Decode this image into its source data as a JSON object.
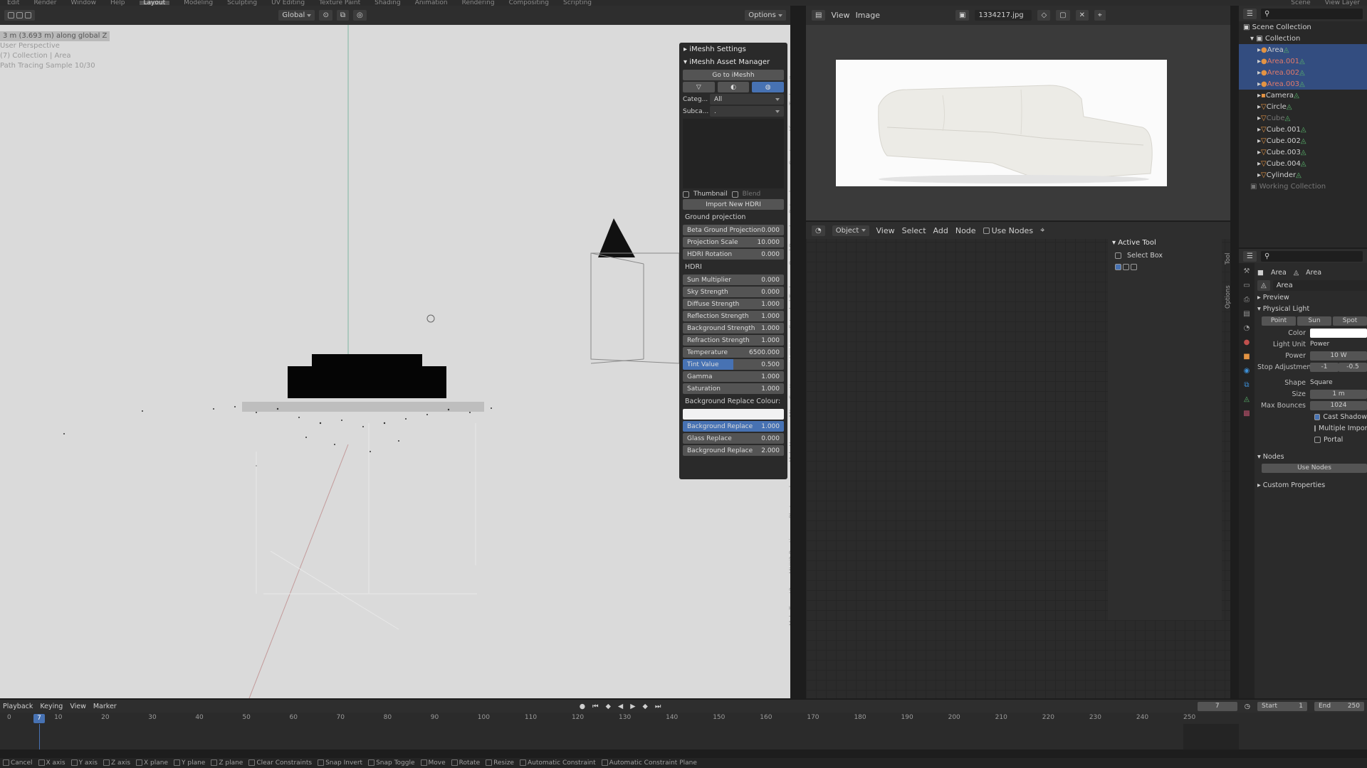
{
  "topbar": {
    "tabs": [
      "Edit",
      "Render",
      "Window",
      "Help",
      "Layout",
      "Modeling",
      "Sculpting",
      "UV Editing",
      "Texture Paint",
      "Shading",
      "Animation",
      "Rendering",
      "Compositing",
      "Scripting"
    ],
    "scene": "Scene",
    "view_layer": "View Layer"
  },
  "viewport": {
    "orientation": "Global",
    "options": "Options",
    "info_line1": "3 m (3.693 m) along global Z",
    "info_line2": "User Perspective",
    "info_line3": "(7) Collection | Area",
    "info_line4": "Path Tracing Sample 10/30"
  },
  "npanel": {
    "settings_title": "iMeshh Settings",
    "asset_manager_title": "iMeshh Asset Manager",
    "goto_button": "Go to iMeshh",
    "category_label": "Categ...",
    "category_value": "All",
    "subcategory_label": "Subca...",
    "subcategory_value": ".",
    "thumbnail_label": "Thumbnail",
    "blend_label": "Blend",
    "import_button": "Import New HDRI",
    "ground_section": "Ground projection",
    "ground_fields": [
      {
        "label": "Beta Ground Projection",
        "value": "0.000"
      },
      {
        "label": "Projection Scale",
        "value": "10.000"
      },
      {
        "label": "HDRI Rotation",
        "value": "0.000"
      }
    ],
    "hdri_section": "HDRI",
    "hdri_fields": [
      {
        "label": "Sun Multiplier",
        "value": "0.000"
      },
      {
        "label": "Sky Strength",
        "value": "0.000"
      },
      {
        "label": "Diffuse Strength",
        "value": "1.000"
      },
      {
        "label": "Reflection Strength",
        "value": "1.000"
      },
      {
        "label": "Background Strength",
        "value": "1.000"
      },
      {
        "label": "Refraction Strength",
        "value": "1.000"
      },
      {
        "label": "Temperature",
        "value": "6500.000"
      },
      {
        "label": "Tint Value",
        "value": "0.500"
      },
      {
        "label": "Gamma",
        "value": "1.000"
      },
      {
        "label": "Saturation",
        "value": "1.000"
      }
    ],
    "bg_colour_label": "Background Replace Colour:",
    "bg_fields": [
      {
        "label": "Background Replace",
        "value": "1.000"
      },
      {
        "label": "Glass Replace",
        "value": "0.000"
      },
      {
        "label": "Background Replace",
        "value": "2.000"
      }
    ],
    "vertical_tabs": [
      "Item",
      "Tool",
      "View",
      "Create",
      "Retopology",
      "Quad Remesh",
      "Extended Tools",
      "iMeshh",
      "Scatter",
      "AN",
      "MakeHuman",
      "Photographer",
      "MHX2 Runtime",
      "MakeTarget2"
    ]
  },
  "image_editor": {
    "menu_view": "View",
    "menu_image": "Image",
    "filename": "1334217.jpg"
  },
  "node_editor": {
    "mode": "Object",
    "menu": [
      "View",
      "Select",
      "Add",
      "Node"
    ],
    "use_nodes": "Use Nodes",
    "active_tool_title": "Active Tool",
    "select_box": "Select Box",
    "side_tabs": [
      "Tool",
      "Options"
    ]
  },
  "outliner": {
    "scene_collection": "Scene Collection",
    "collection": "Collection",
    "items": [
      {
        "name": "Area",
        "sel": true,
        "type": "light"
      },
      {
        "name": "Area.001",
        "sel": true,
        "type": "light"
      },
      {
        "name": "Area.002",
        "sel": true,
        "type": "light"
      },
      {
        "name": "Area.003",
        "sel": true,
        "type": "light"
      },
      {
        "name": "Camera",
        "sel": false,
        "type": "camera"
      },
      {
        "name": "Circle",
        "sel": false,
        "type": "mesh"
      },
      {
        "name": "Cube",
        "sel": false,
        "type": "mesh"
      },
      {
        "name": "Cube.001",
        "sel": false,
        "type": "mesh"
      },
      {
        "name": "Cube.002",
        "sel": false,
        "type": "mesh"
      },
      {
        "name": "Cube.003",
        "sel": false,
        "type": "mesh"
      },
      {
        "name": "Cube.004",
        "sel": false,
        "type": "mesh"
      },
      {
        "name": "Cylinder",
        "sel": false,
        "type": "mesh"
      }
    ],
    "working_collection": "Working Collection"
  },
  "properties": {
    "breadcrumb_obj": "Area",
    "breadcrumb_data": "Area",
    "data_name": "Area",
    "preview": "Preview",
    "physical_light": "Physical Light",
    "light_types": [
      "Point",
      "Sun",
      "Spot"
    ],
    "color_label": "Color",
    "light_unit_label": "Light Unit",
    "light_unit_value": "Power",
    "power_label": "Power",
    "power_value": "10 W",
    "stop_label": "Stop Adjustment",
    "stop_values": [
      "-1",
      "-0.5"
    ],
    "shape_label": "Shape",
    "shape_value": "Square",
    "size_label": "Size",
    "size_value": "1 m",
    "bounces_label": "Max Bounces",
    "bounces_value": "1024",
    "checks": [
      "Cast Shadow",
      "Multiple Importance",
      "Portal"
    ],
    "nodes_section": "Nodes",
    "use_nodes_btn": "Use Nodes",
    "custom_props": "Custom Properties"
  },
  "timeline": {
    "menus": [
      "Playback",
      "Keying",
      "View",
      "Marker"
    ],
    "current_frame": "7",
    "start_label": "Start",
    "start_value": "1",
    "end_label": "End",
    "end_value": "250",
    "ticks": [
      "0",
      "10",
      "20",
      "30",
      "40",
      "50",
      "60",
      "70",
      "80",
      "90",
      "100",
      "110",
      "120",
      "130",
      "140",
      "150",
      "160",
      "170",
      "180",
      "190",
      "200",
      "210",
      "220",
      "230",
      "240",
      "250"
    ]
  },
  "statusbar": {
    "items": [
      "Cancel",
      "X axis",
      "Y axis",
      "Z axis",
      "X plane",
      "Y plane",
      "Z plane",
      "Clear Constraints",
      "Snap Invert",
      "Snap Toggle",
      "Move",
      "Rotate",
      "Resize",
      "Automatic Constraint",
      "Automatic Constraint Plane"
    ]
  }
}
